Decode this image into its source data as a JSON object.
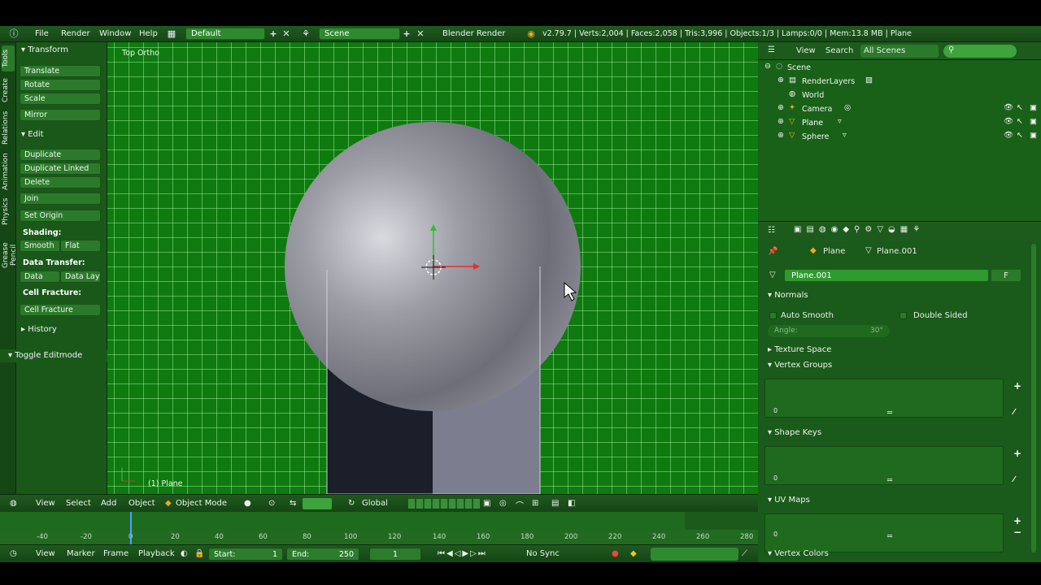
{
  "topbar": {
    "menus": [
      "File",
      "Render",
      "Window",
      "Help"
    ],
    "layout": "Default",
    "scene": "Scene",
    "engine": "Blender Render",
    "stats": "v2.79.7 | Verts:2,004 | Faces:2,058 | Tris:3,996 | Objects:1/3 | Lamps:0/0 | Mem:13.8 MB | Plane"
  },
  "left_tabs": [
    "Tools",
    "Create",
    "Relations",
    "Animation",
    "Physics",
    "Grease Pencil"
  ],
  "tools": {
    "transform_header": "Transform",
    "translate": "Translate",
    "rotate": "Rotate",
    "scale": "Scale",
    "mirror": "Mirror",
    "edit_header": "Edit",
    "duplicate": "Duplicate",
    "duplicate_linked": "Duplicate Linked",
    "delete": "Delete",
    "join": "Join",
    "set_origin": "Set Origin",
    "shading_label": "Shading:",
    "smooth": "Smooth",
    "flat": "Flat",
    "data_transfer_label": "Data Transfer:",
    "data": "Data",
    "data_layout": "Data Layt",
    "cell_fracture_label": "Cell Fracture:",
    "cell_fracture": "Cell Fracture",
    "history": "History",
    "toggle_editmode": "Toggle Editmode"
  },
  "viewport": {
    "view_name": "Top Ortho",
    "object_label": "(1) Plane"
  },
  "vp_header": {
    "view": "View",
    "select": "Select",
    "add": "Add",
    "object": "Object",
    "mode": "Object Mode",
    "orientation": "Global"
  },
  "timeline": {
    "ticks": [
      "-40",
      "-20",
      "0",
      "20",
      "40",
      "60",
      "80",
      "100",
      "120",
      "140",
      "160",
      "180",
      "200",
      "220",
      "240",
      "260",
      "280"
    ],
    "view": "View",
    "marker": "Marker",
    "frame": "Frame",
    "playback": "Playback",
    "start_label": "Start:",
    "start_value": "1",
    "end_label": "End:",
    "end_value": "250",
    "current_frame": "1",
    "sync": "No Sync"
  },
  "outliner": {
    "view": "View",
    "search": "Search",
    "filter": "All Scenes",
    "items": [
      "Scene",
      "RenderLayers",
      "World",
      "Camera",
      "Plane",
      "Sphere"
    ]
  },
  "properties": {
    "context_object": "Plane",
    "context_mesh": "Plane.001",
    "mesh_name": "Plane.001",
    "fake_user": "F",
    "normals": "Normals",
    "auto_smooth": "Auto Smooth",
    "double_sided": "Double Sided",
    "angle_label": "Angle:",
    "angle_value": "30°",
    "texture_space": "Texture Space",
    "vertex_groups": "Vertex Groups",
    "shape_keys": "Shape Keys",
    "uv_maps": "UV Maps",
    "vertex_colors": "Vertex Colors",
    "list_index": "0"
  },
  "colors": {
    "theme_green": "#1a5a1a",
    "viewport_green": "#0f7a0f",
    "selected_field": "#2f9a2f"
  }
}
